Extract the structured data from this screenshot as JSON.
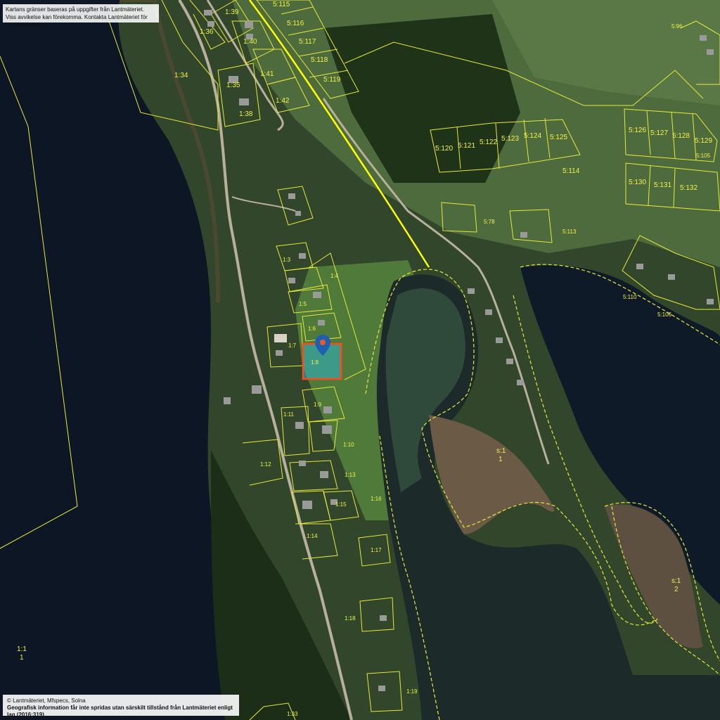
{
  "notices": {
    "top_line1": "Kartans gränser baseras på uppgifter från Lantmäteriet.",
    "top_line2": "Viss avvikelse kan förekomma. Kontakta Lantmäteriet för mer information.",
    "bottom_line1": "© Lantmäteriet, Mfspecs, Solna",
    "bottom_line2": "Geografisk information får inte spridas utan särskilt tillstånd från Lantmäteriet enligt lag (2016:319)"
  },
  "parcels": {
    "p_1_36": "1:36",
    "p_1_39": "1:39",
    "p_1_40": "1:40",
    "p_1_41": "1:41",
    "p_1_42": "1:42",
    "p_1_35": "1:35",
    "p_1_38": "1:38",
    "p_1_34": "1:34",
    "p_5_115": "5:115",
    "p_5_116": "5:116",
    "p_5_117": "5:117",
    "p_5_118": "5:118",
    "p_5_119": "5:119",
    "p_5_96": "5:96",
    "p_5_120": "5:120",
    "p_5_121": "5:121",
    "p_5_122": "5:122",
    "p_5_123": "5:123",
    "p_5_124": "5:124",
    "p_5_125": "5:125",
    "p_5_114": "5:114",
    "p_5_126": "5:126",
    "p_5_127": "5:127",
    "p_5_128": "5:128",
    "p_5_129": "5:129",
    "p_5_105": "5:105",
    "p_5_130": "5:130",
    "p_5_131": "5:131",
    "p_5_132": "5:132",
    "p_5_78": "5:78",
    "p_5_113": "5:113",
    "p_5_110": "5:110",
    "p_5_106": "5:106",
    "p_1_3": "1:3",
    "p_1_4": "1:4",
    "p_1_5": "1:5",
    "p_1_6": "1:6",
    "p_1_7": "1:7",
    "p_1_8": "1:8",
    "p_1_9": "1:9",
    "p_1_11": "1:11",
    "p_1_10": "1:10",
    "p_1_12": "1:12",
    "p_1_13": "1:13",
    "p_1_16": "1:16",
    "p_1_15": "1:15",
    "p_1_14": "1:14",
    "p_1_17": "1:17",
    "p_1_18": "1:18",
    "p_1_19": "1:19",
    "p_1_33": "1:33",
    "p_s_1": "s:1",
    "p_s_1_num": "1",
    "p_s_1b": "s:1",
    "p_s_1b_num": "2",
    "p_1_1": "1:1",
    "p_1_1_num": "1"
  },
  "colors": {
    "parcel_line": "#e8e83a",
    "road_line": "#ffff00",
    "selected_outline": "#ff4a1c",
    "selected_fill": "#2fb3c9",
    "marker": "#1f5fb0",
    "water": "#0d1625",
    "forest": "#24391f",
    "meadow": "#4f7a3a"
  },
  "icons": {
    "marker": "map-pin-icon"
  }
}
